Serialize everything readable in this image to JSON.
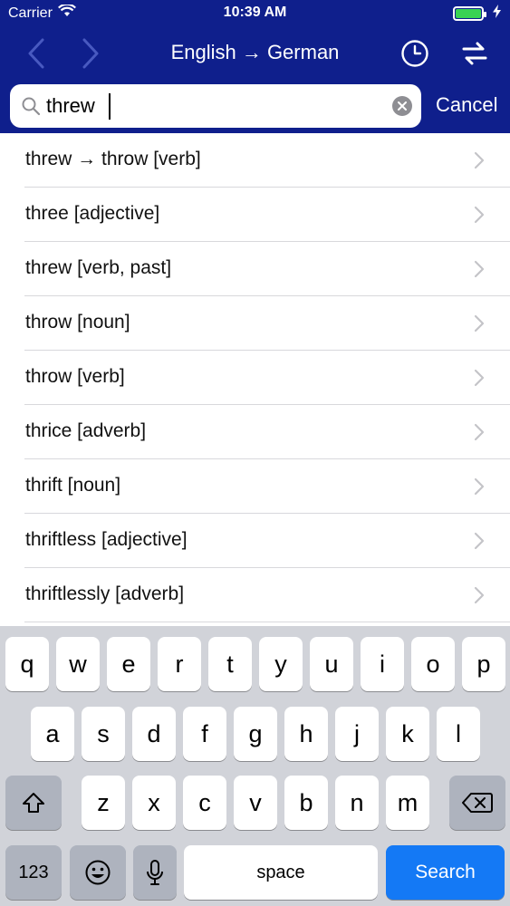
{
  "status": {
    "carrier": "Carrier",
    "time": "10:39 AM"
  },
  "nav": {
    "title": "English → German"
  },
  "search": {
    "value": "threw",
    "cancel_label": "Cancel"
  },
  "results": [
    {
      "label": "threw → throw [verb]"
    },
    {
      "label": "three [adjective]"
    },
    {
      "label": "threw [verb, past]"
    },
    {
      "label": "throw [noun]"
    },
    {
      "label": "throw [verb]"
    },
    {
      "label": "thrice [adverb]"
    },
    {
      "label": "thrift [noun]"
    },
    {
      "label": "thriftless [adjective]"
    },
    {
      "label": "thriftlessly [adverb]"
    }
  ],
  "keyboard": {
    "row1": [
      "q",
      "w",
      "e",
      "r",
      "t",
      "y",
      "u",
      "i",
      "o",
      "p"
    ],
    "row2": [
      "a",
      "s",
      "d",
      "f",
      "g",
      "h",
      "j",
      "k",
      "l"
    ],
    "row3": [
      "z",
      "x",
      "c",
      "v",
      "b",
      "n",
      "m"
    ],
    "numbers_label": "123",
    "space_label": "space",
    "search_label": "Search"
  },
  "colors": {
    "header": "#0f1f8c",
    "search_key": "#1479f5",
    "battery": "#39d353"
  }
}
